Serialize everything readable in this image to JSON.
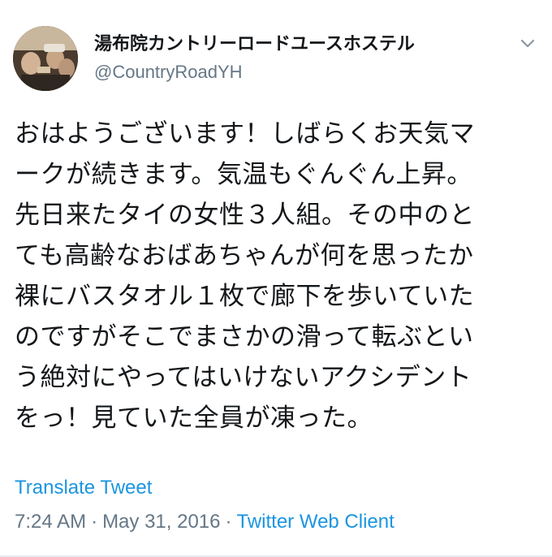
{
  "user": {
    "display_name": "湯布院カントリーロードユースホステル",
    "handle": "@CountryRoadYH"
  },
  "tweet": {
    "text": "おはようございます！しばらくお天気マ\nークが続きます。気温もぐんぐん上昇。\n先日来たタイの女性３人組。その中のと\nても高齢なおばあちゃんが何を思ったか\n裸にバスタオル１枚で廊下を歩いていた\nのですがそこでまさかの滑って転ぶとい\nう絶対にやってはいけないアクシデント\nをっ！見ていた全員が凍った。"
  },
  "actions": {
    "translate_label": "Translate Tweet"
  },
  "meta": {
    "time": "7:24 AM",
    "separator": "·",
    "date": "May 31, 2016",
    "client": "Twitter Web Client"
  },
  "icons": {
    "menu": "chevron-down-icon",
    "avatar": "profile-photo"
  },
  "colors": {
    "text": "#14171a",
    "secondary": "#657786",
    "link": "#1b95e0"
  }
}
